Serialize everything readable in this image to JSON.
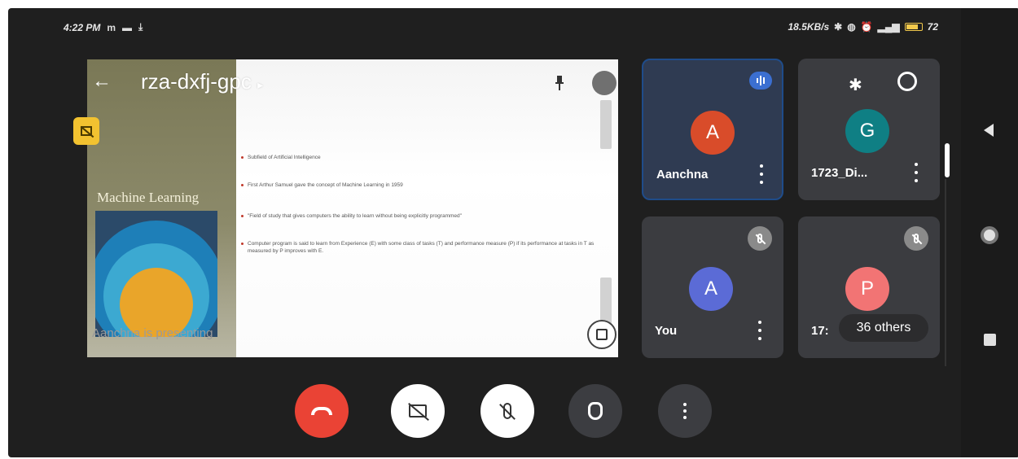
{
  "status_bar": {
    "time": "4:22 PM",
    "carrier_icons": "m",
    "network_speed": "18.5KB/s",
    "battery": "72"
  },
  "presentation": {
    "meeting_code": "rza-dxfj-gpc",
    "code_caret": "▸",
    "slide_title": "Machine Learning",
    "bullets": [
      "Subfield of Artificial Intelligence",
      "First Arthur Samuel gave the concept of Machine Learning in 1959",
      "\"Field of study that gives computers the ability to learn without being explicitly programmed\"",
      "Computer program is said to learn from Experience (E) with some class of tasks (T) and performance measure (P) if its performance at tasks in T as measured by P improves with E."
    ],
    "presenter_label": "Aanchna is presenting"
  },
  "participants": [
    {
      "initial": "A",
      "name": "Aanchna",
      "color": "#d94c2a",
      "state": "speaking"
    },
    {
      "initial": "G",
      "name": "1723_Di...",
      "color": "#0f7f84",
      "state": "none"
    },
    {
      "initial": "A",
      "name": "You",
      "color": "#5b6bd6",
      "state": "muted"
    },
    {
      "initial": "P",
      "name": "17:",
      "color": "#f27474",
      "state": "muted",
      "others_label": "36 others"
    }
  ],
  "controls": {
    "hangup": "end-call",
    "camera": "camera-off",
    "mic": "mic-off",
    "hand": "raise-hand",
    "more": "more-options"
  },
  "colors": {
    "hangup": "#ea4335",
    "active_tile_border": "#1f4c8a",
    "badge": "#f2c230"
  }
}
